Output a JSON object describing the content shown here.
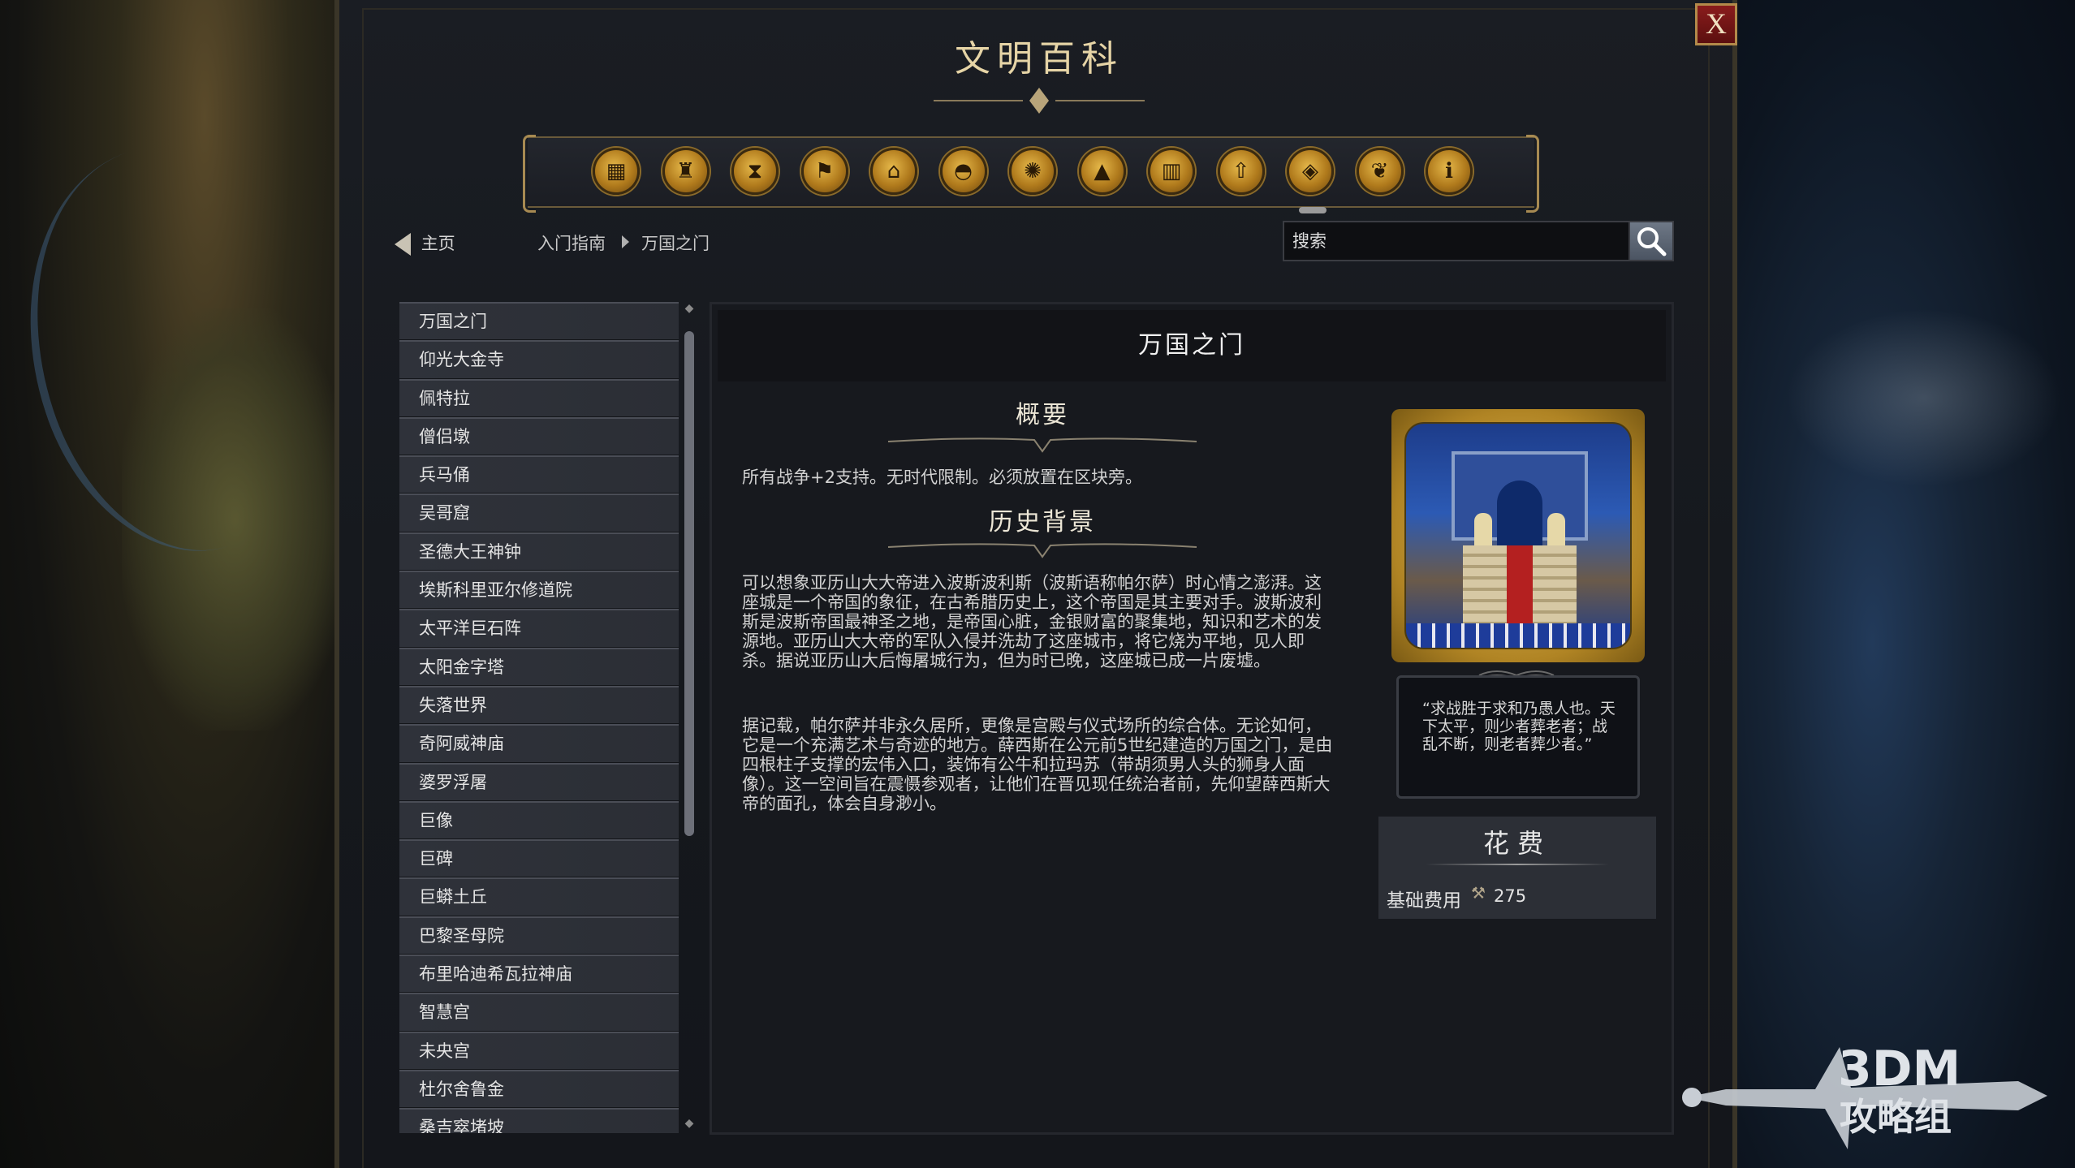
{
  "window": {
    "title": "文明百科",
    "close_label": "X"
  },
  "categories": [
    {
      "icon": "package-icon",
      "glyph": "▦"
    },
    {
      "icon": "cup-icon",
      "glyph": "♜"
    },
    {
      "icon": "hourglass-icon",
      "glyph": "⧗"
    },
    {
      "icon": "flag-icon",
      "glyph": "⚑"
    },
    {
      "icon": "building-icon",
      "glyph": "⌂"
    },
    {
      "icon": "dome-icon",
      "glyph": "◓"
    },
    {
      "icon": "atom-icon",
      "glyph": "✺"
    },
    {
      "icon": "mountain-icon",
      "glyph": "▲"
    },
    {
      "icon": "city-icon",
      "glyph": "▥"
    },
    {
      "icon": "upgrade-icon",
      "glyph": "⇧"
    },
    {
      "icon": "wonder-icon",
      "glyph": "◈",
      "active": true
    },
    {
      "icon": "dove-icon",
      "glyph": "❦"
    },
    {
      "icon": "info-icon",
      "glyph": "ℹ"
    }
  ],
  "nav": {
    "home_label": "主页",
    "breadcrumb": [
      "入门指南",
      "万国之门"
    ]
  },
  "search": {
    "placeholder": "搜索",
    "value": ""
  },
  "list_items": [
    "万国之门",
    "仰光大金寺",
    "佩特拉",
    "僧侣墩",
    "兵马俑",
    "吴哥窟",
    "圣德大王神钟",
    "埃斯科里亚尔修道院",
    "太平洋巨石阵",
    "太阳金字塔",
    "失落世界",
    "奇阿威神庙",
    "婆罗浮屠",
    "巨像",
    "巨碑",
    "巨蟒土丘",
    "巴黎圣母院",
    "布里哈迪希瓦拉神庙",
    "智慧宫",
    "未央宫",
    "杜尔舍鲁金",
    "桑吉窣堵坡"
  ],
  "article": {
    "title": "万国之门",
    "overview_heading": "概要",
    "overview_text": "所有战争+2支持。无时代限制。必须放置在区块旁。",
    "history_heading": "历史背景",
    "history_p1": "可以想象亚历山大大帝进入波斯波利斯（波斯语称帕尔萨）时心情之澎湃。这座城是一个帝国的象征，在古希腊历史上，这个帝国是其主要对手。波斯波利斯是波斯帝国最神圣之地，是帝国心脏，金银财富的聚集地，知识和艺术的发源地。亚历山大大帝的军队入侵并洗劫了这座城市，将它烧为平地，见人即杀。据说亚历山大后悔屠城行为，但为时已晚，这座城已成一片废墟。",
    "history_p2": "据记载，帕尔萨并非永久居所，更像是宫殿与仪式场所的综合体。无论如何，它是一个充满艺术与奇迹的地方。薛西斯在公元前5世纪建造的万国之门，是由四根柱子支撑的宏伟入口，装饰有公牛和拉玛苏（带胡须男人头的狮身人面像）。这一空间旨在震慑参观者，让他们在晋见现任统治者前，先仰望薛西斯大帝的面孔，体会自身渺小。",
    "quote": "“求战胜于求和乃愚人也。天下太平，则少者葬老者；战乱不断，则老者葬少者。”",
    "cost_heading": "花费",
    "cost_label": "基础费用",
    "cost_icon": "hammer-icon",
    "cost_value": "275"
  },
  "watermark": {
    "line1": "3DM",
    "line2": "攻略组"
  }
}
